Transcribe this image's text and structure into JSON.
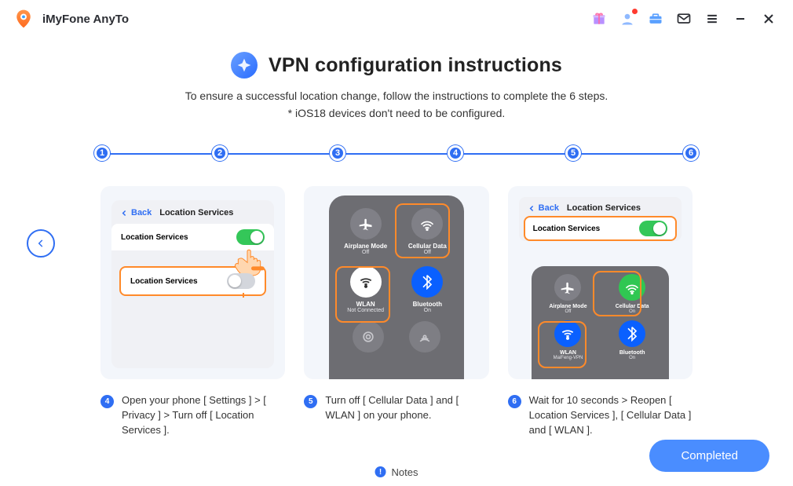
{
  "app": {
    "name": "iMyFone AnyTo"
  },
  "header": {
    "title": "VPN configuration instructions",
    "subtitle1": "To ensure a successful location change, follow the instructions to complete the 6 steps.",
    "subtitle2": "* iOS18 devices don't need to be configured."
  },
  "steps": [
    "1",
    "2",
    "3",
    "4",
    "5",
    "6"
  ],
  "card4": {
    "back": "Back",
    "title": "Location Services",
    "row1": "Location Services",
    "row2": "Location Services"
  },
  "card5": {
    "airplane": {
      "label": "Airplane Mode",
      "sub": "Off"
    },
    "cellular": {
      "label": "Cellular Data",
      "sub": "Off"
    },
    "wlan": {
      "label": "WLAN",
      "sub": "Not Connected"
    },
    "bluetooth": {
      "label": "Bluetooth",
      "sub": "On"
    }
  },
  "card6": {
    "back": "Back",
    "title": "Location Services",
    "row": "Location Services",
    "airplane": {
      "label": "Airplane Mode",
      "sub": "Off"
    },
    "cellular": {
      "label": "Cellular Data",
      "sub": "On"
    },
    "wlan": {
      "label": "WLAN",
      "sub": "MaiFeng-VPN"
    },
    "bluetooth": {
      "label": "Bluetooth",
      "sub": "On"
    }
  },
  "captions": {
    "c4": {
      "n": "4",
      "text": "Open your phone [ Settings ] > [ Privacy ] > Turn off [ Location Services ]."
    },
    "c5": {
      "n": "5",
      "text": "Turn off [ Cellular Data ] and [ WLAN ] on your phone."
    },
    "c6": {
      "n": "6",
      "text": "Wait for 10 seconds > Reopen [ Location Services ], [ Cellular Data ] and [ WLAN ]."
    }
  },
  "footer": {
    "notes": "Notes",
    "completed": "Completed"
  }
}
